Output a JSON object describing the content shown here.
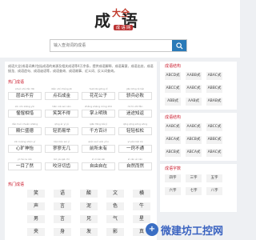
{
  "header": {
    "logo": {
      "c1": "成",
      "c2": "大全",
      "c3": "语",
      "sub": "成 语 网"
    },
    "search_placeholder": "输入查询词的成语"
  },
  "main": {
    "intro": "成语大全(成语词典)包括成语的来源及相关成语等4万余条，提供成语解释、成语寓意、成语出处、成语接龙、成语造句、成语谜语等，成语查询、成语故事、近义词、反义词查询。",
    "hot_idioms_title": "热门成语",
    "hot_idioms": [
      {
        "py": "shuò shù fàn fēi",
        "word": "层出不穷"
      },
      {
        "py": "diǎn shí chéng jīn",
        "word": "点石成金"
      },
      {
        "py": "huā kāi gōng zǐ",
        "word": "花花公子"
      },
      {
        "py": "jiāo bīng bì bài",
        "word": "骄兵必败"
      },
      {
        "py": "xīn xīn xiāng yìn",
        "word": "惺惺相惜"
      },
      {
        "py": "tiān xià wú nán",
        "word": "笑哭不得"
      },
      {
        "py": "zhǎng shàng míng zhū",
        "word": "掌上明珠"
      },
      {
        "py": "mí tú zhī fǎn",
        "word": "迷途知返"
      },
      {
        "py": "dǎo huǒ chuán shēng",
        "word": "殿仁盛德"
      },
      {
        "py": "qīng ér yì jǔ",
        "word": "轻而易举"
      },
      {
        "py": "qiān fāng bǎi jì",
        "word": "千方百计"
      },
      {
        "py": "qīng qīng sōng sōng",
        "word": "轻轻松松"
      },
      {
        "py": "xīn kuàng shén yí",
        "word": "心旷神怡"
      },
      {
        "py": "liáo liáo wú jǐ",
        "word": "寥寥无几"
      },
      {
        "py": "qián suǒ wèi yǒu",
        "word": "前所未有"
      },
      {
        "py": "yī pǎo bǎi kè",
        "word": "一窍不通"
      },
      {
        "py": "yī mù le rán",
        "word": "一目了然"
      },
      {
        "py": "bō yá qiē chǐ",
        "word": "咬牙切齿"
      },
      {
        "py": "zì zì zài zài",
        "word": "自由自在"
      },
      {
        "py": "zì rán ér rán",
        "word": "自然而然"
      }
    ],
    "hot_chars_title": "热门成语",
    "hot_chars": [
      "笑",
      "语",
      "酸",
      "文",
      "横",
      "声",
      "言",
      "泥",
      "色",
      "牛",
      "男",
      "言",
      "兄",
      "气",
      "星",
      "夹",
      "身",
      "发",
      "影",
      "真",
      "猫",
      "打",
      "人",
      "心",
      "年"
    ]
  },
  "sidebar": {
    "sections": [
      {
        "title": "成语结构",
        "tags": [
          "ABCD式",
          "AABB式",
          "ABAC式",
          "ABCC式",
          "AABC式",
          "ABBC式",
          "ABB式",
          "AAB式",
          "ABAB式"
        ]
      },
      {
        "title": "成语结构",
        "tags": [
          "AABC式",
          "AABC式",
          "ABCC式",
          "ABCA式",
          "ABCB式",
          "ABBC式",
          "ABCB式",
          "ABCA式",
          "ABAC式"
        ]
      },
      {
        "title": "成语字数",
        "tags": [
          "四字",
          "三字",
          "五字",
          "六字",
          "七字",
          "八字"
        ]
      }
    ]
  },
  "watermark": {
    "icon": "+",
    "text": "微建坊工控网"
  },
  "colors": {
    "accent": "#cc2233",
    "search_button": "#2a7ab8",
    "watermark": "#3a63c0"
  }
}
